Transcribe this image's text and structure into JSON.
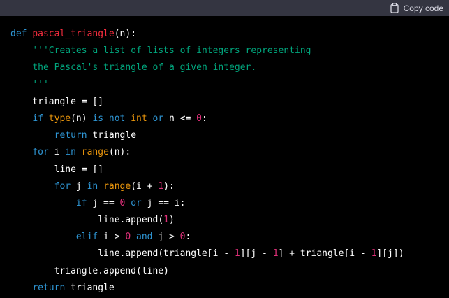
{
  "header": {
    "copy_label": "Copy code",
    "icon": "clipboard-icon"
  },
  "colors": {
    "background": "#000000",
    "header_bg": "#343541",
    "keyword": "#2e95d3",
    "function_name": "#f22c3d",
    "builtin": "#e9950c",
    "number": "#df3079",
    "string": "#00a67d",
    "text": "#ffffff"
  },
  "code": {
    "language": "python",
    "lines": [
      [
        {
          "t": "def",
          "c": "kw"
        },
        {
          "t": " "
        },
        {
          "t": "pascal_triangle",
          "c": "fn"
        },
        {
          "t": "(n):"
        }
      ],
      [
        {
          "t": "    "
        },
        {
          "t": "'''Creates a list of lists of integers representing",
          "c": "str"
        }
      ],
      [
        {
          "t": "    "
        },
        {
          "t": "the Pascal's triangle of a given integer.",
          "c": "str"
        }
      ],
      [
        {
          "t": "    "
        },
        {
          "t": "'''",
          "c": "str"
        }
      ],
      [
        {
          "t": "    triangle = []"
        }
      ],
      [
        {
          "t": "    "
        },
        {
          "t": "if",
          "c": "kw"
        },
        {
          "t": " "
        },
        {
          "t": "type",
          "c": "bi"
        },
        {
          "t": "(n) "
        },
        {
          "t": "is",
          "c": "kw"
        },
        {
          "t": " "
        },
        {
          "t": "not",
          "c": "kw"
        },
        {
          "t": " "
        },
        {
          "t": "int",
          "c": "bi"
        },
        {
          "t": " "
        },
        {
          "t": "or",
          "c": "kw"
        },
        {
          "t": " n <= "
        },
        {
          "t": "0",
          "c": "num"
        },
        {
          "t": ":"
        }
      ],
      [
        {
          "t": "        "
        },
        {
          "t": "return",
          "c": "kw"
        },
        {
          "t": " triangle"
        }
      ],
      [
        {
          "t": "    "
        },
        {
          "t": "for",
          "c": "kw"
        },
        {
          "t": " i "
        },
        {
          "t": "in",
          "c": "kw"
        },
        {
          "t": " "
        },
        {
          "t": "range",
          "c": "bi"
        },
        {
          "t": "(n):"
        }
      ],
      [
        {
          "t": "        line = []"
        }
      ],
      [
        {
          "t": "        "
        },
        {
          "t": "for",
          "c": "kw"
        },
        {
          "t": " j "
        },
        {
          "t": "in",
          "c": "kw"
        },
        {
          "t": " "
        },
        {
          "t": "range",
          "c": "bi"
        },
        {
          "t": "(i + "
        },
        {
          "t": "1",
          "c": "num"
        },
        {
          "t": "):"
        }
      ],
      [
        {
          "t": "            "
        },
        {
          "t": "if",
          "c": "kw"
        },
        {
          "t": " j == "
        },
        {
          "t": "0",
          "c": "num"
        },
        {
          "t": " "
        },
        {
          "t": "or",
          "c": "kw"
        },
        {
          "t": " j == i:"
        }
      ],
      [
        {
          "t": "                line.append("
        },
        {
          "t": "1",
          "c": "num"
        },
        {
          "t": ")"
        }
      ],
      [
        {
          "t": "            "
        },
        {
          "t": "elif",
          "c": "kw"
        },
        {
          "t": " i > "
        },
        {
          "t": "0",
          "c": "num"
        },
        {
          "t": " "
        },
        {
          "t": "and",
          "c": "kw"
        },
        {
          "t": " j > "
        },
        {
          "t": "0",
          "c": "num"
        },
        {
          "t": ":"
        }
      ],
      [
        {
          "t": "                line.append(triangle[i - "
        },
        {
          "t": "1",
          "c": "num"
        },
        {
          "t": "][j - "
        },
        {
          "t": "1",
          "c": "num"
        },
        {
          "t": "] + triangle[i - "
        },
        {
          "t": "1",
          "c": "num"
        },
        {
          "t": "][j])"
        }
      ],
      [
        {
          "t": "        triangle.append(line)"
        }
      ],
      [
        {
          "t": "    "
        },
        {
          "t": "return",
          "c": "kw"
        },
        {
          "t": " triangle"
        }
      ]
    ]
  }
}
